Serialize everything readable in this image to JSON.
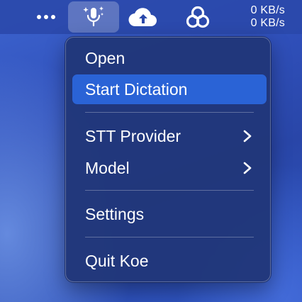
{
  "menubar": {
    "icons": [
      "more-icon",
      "microphone-sparkle-icon",
      "cloud-sync-icon",
      "triad-logo-icon"
    ],
    "network_speed": {
      "upload": "0 KB/s",
      "download": "0 KB/s"
    }
  },
  "menu": {
    "items": [
      {
        "label": "Open"
      },
      {
        "label": "Start Dictation",
        "highlighted": true
      },
      {
        "label": "STT Provider",
        "submenu": true
      },
      {
        "label": "Model",
        "submenu": true
      },
      {
        "label": "Settings"
      },
      {
        "label": "Quit Koe"
      }
    ]
  },
  "colors": {
    "highlight": "#2a63d6",
    "menu_background": "#21377a",
    "menubar": "#2a48aa"
  }
}
